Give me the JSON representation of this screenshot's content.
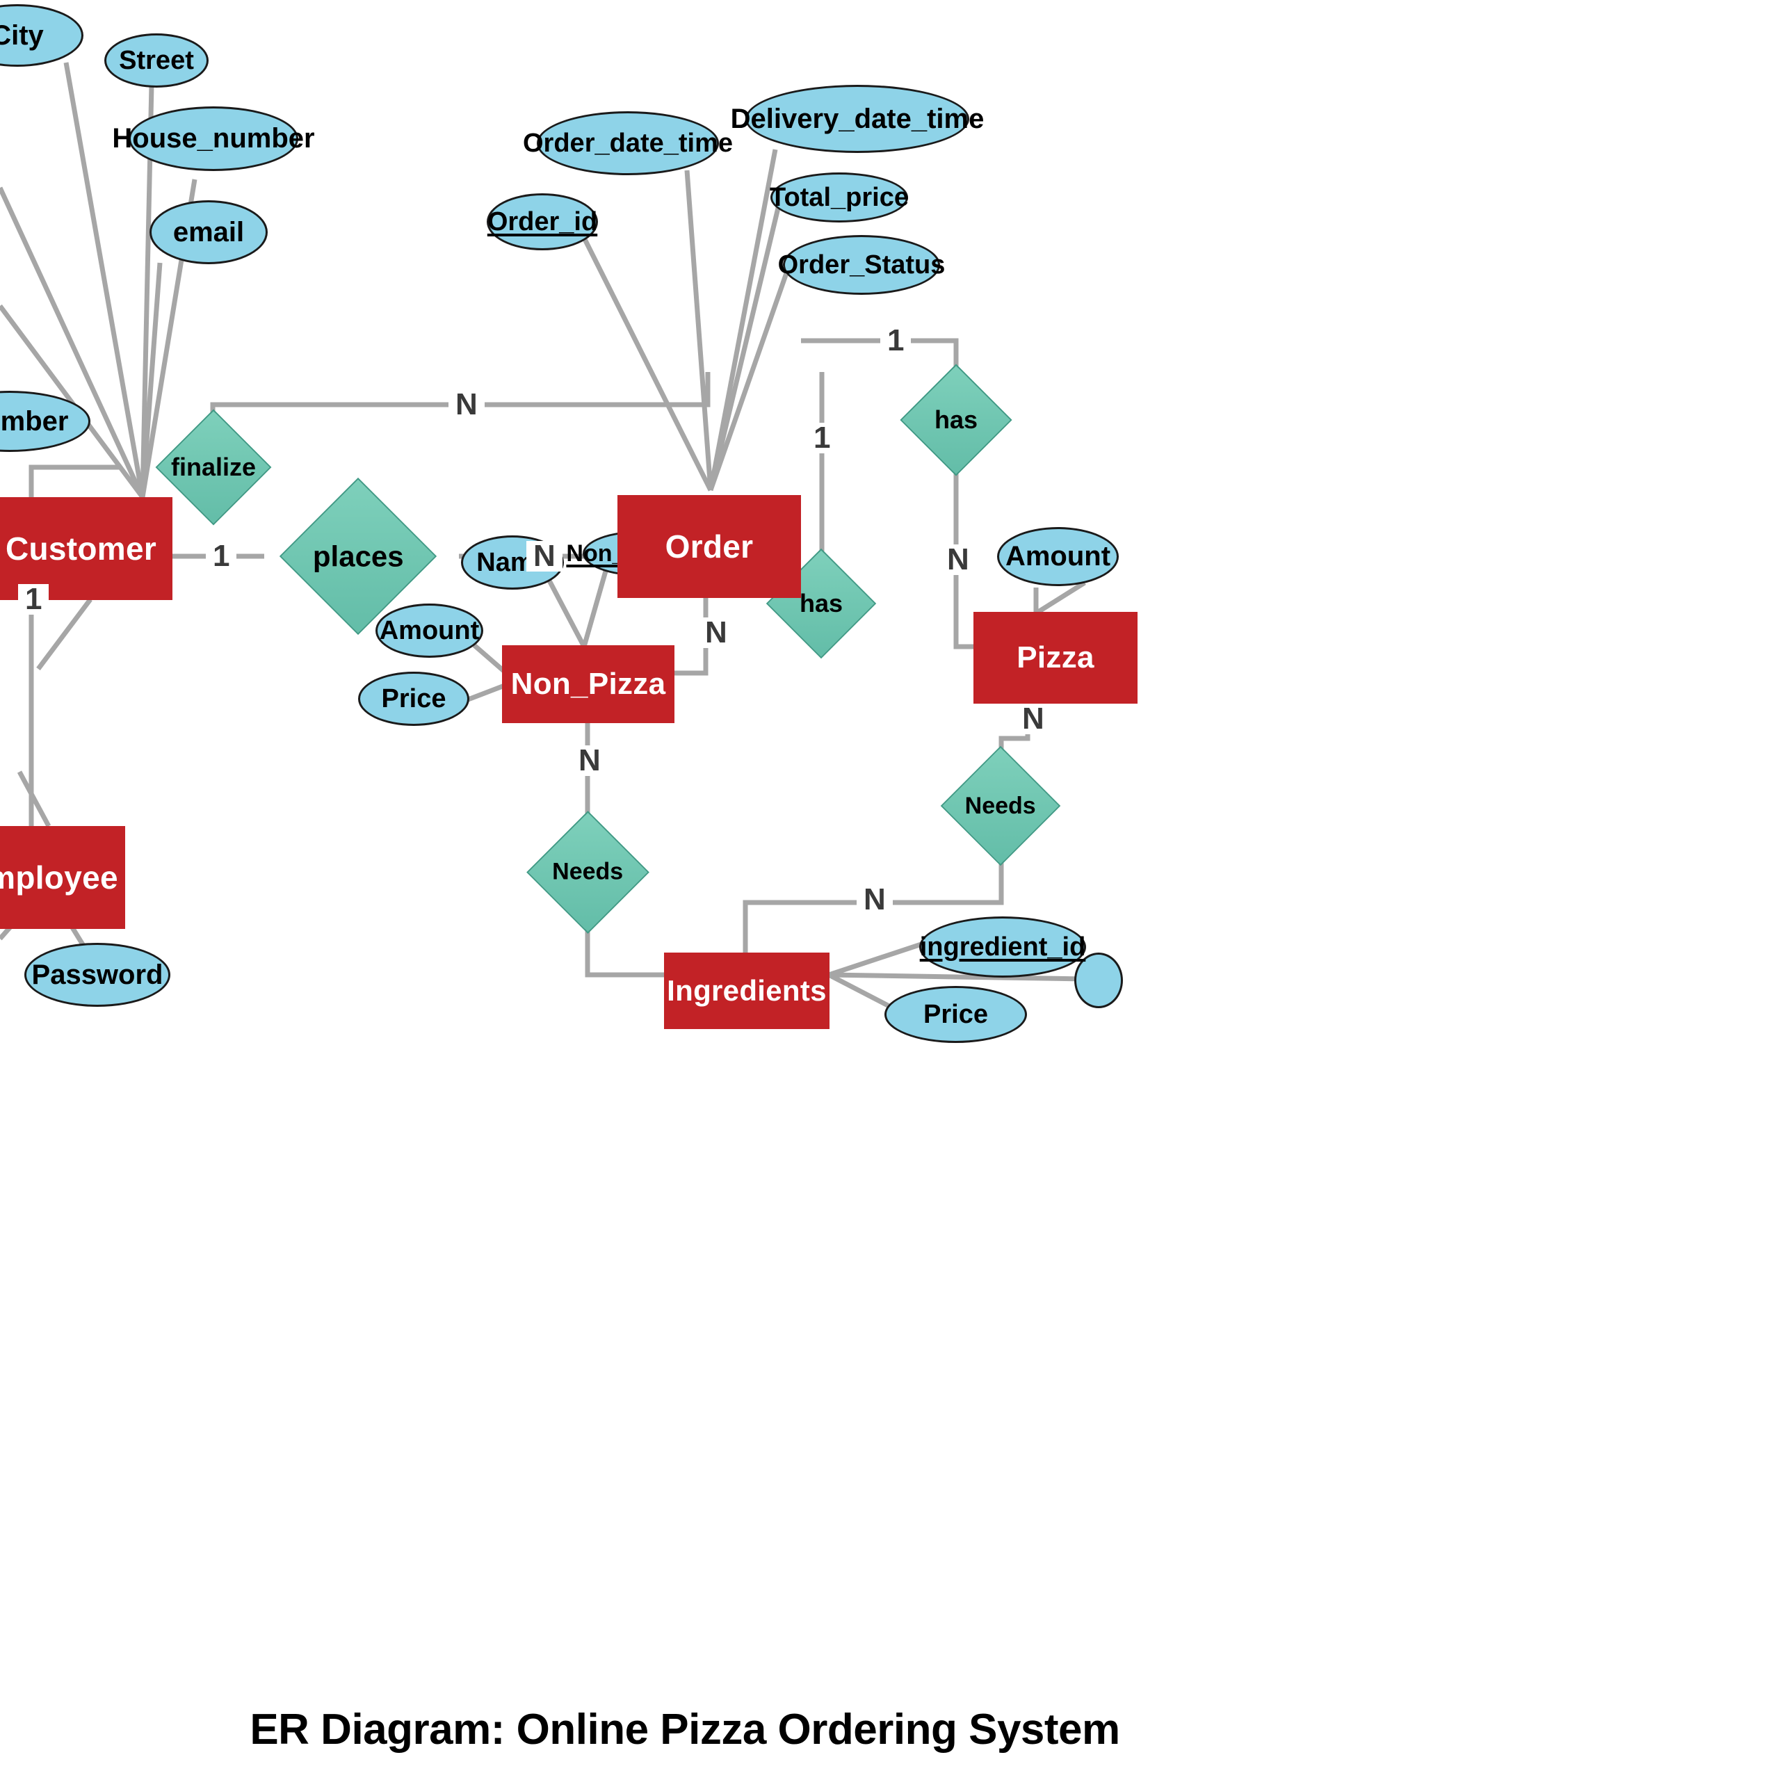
{
  "title": "ER Diagram: Online Pizza Ordering System",
  "palette": {
    "entity_fill": "#c22226",
    "entity_text": "#ffffff",
    "attribute_fill": "#8ed3e8",
    "attribute_stroke": "#1a1a1a",
    "relationship_fill": "#6cc4b0",
    "relationship_stroke": "#3f9a85",
    "connector": "#a6a6a6",
    "background": "#ffffff",
    "label_text": "#3a3a3a"
  },
  "entities": [
    {
      "id": "customer",
      "label": "Customer"
    },
    {
      "id": "order",
      "label": "Order"
    },
    {
      "id": "employee",
      "label": "Employee"
    },
    {
      "id": "non_pizza",
      "label": "Non_Pizza"
    },
    {
      "id": "pizza",
      "label": "Pizza"
    },
    {
      "id": "ingredients",
      "label": "Ingredients"
    }
  ],
  "relationships": [
    {
      "id": "places",
      "label": "places"
    },
    {
      "id": "finalize",
      "label": "finalize"
    },
    {
      "id": "has_pizza",
      "label": "has"
    },
    {
      "id": "has_nonpizza",
      "label": "has"
    },
    {
      "id": "needs_np",
      "label": "Needs"
    },
    {
      "id": "needs_pz",
      "label": "Needs"
    }
  ],
  "attributes": [
    {
      "id": "city",
      "label": "City",
      "owner": "customer",
      "key": false
    },
    {
      "id": "street",
      "label": "Street",
      "owner": "customer",
      "key": false
    },
    {
      "id": "house_number",
      "label": "House_number",
      "owner": "customer",
      "key": false
    },
    {
      "id": "email",
      "label": "email",
      "owner": "customer",
      "key": false
    },
    {
      "id": "phone_number",
      "label": "_number",
      "owner": "customer",
      "key": false
    },
    {
      "id": "order_id",
      "label": "Order_id",
      "owner": "order",
      "key": true
    },
    {
      "id": "order_date_time",
      "label": "Order_date_time",
      "owner": "order",
      "key": false
    },
    {
      "id": "delivery_date_time",
      "label": "Delivery_date_time",
      "owner": "order",
      "key": false
    },
    {
      "id": "total_price",
      "label": "Total_price",
      "owner": "order",
      "key": false
    },
    {
      "id": "order_status",
      "label": "Order_Status",
      "owner": "order",
      "key": false
    },
    {
      "id": "password",
      "label": "Password",
      "owner": "employee",
      "key": false
    },
    {
      "id": "np_name",
      "label": "Name",
      "owner": "non_pizza",
      "key": false
    },
    {
      "id": "np_id",
      "label": "Non_Pizza_id",
      "owner": "non_pizza",
      "key": true
    },
    {
      "id": "np_amount",
      "label": "Amount",
      "owner": "non_pizza",
      "key": false
    },
    {
      "id": "np_price",
      "label": "Price",
      "owner": "non_pizza",
      "key": false
    },
    {
      "id": "pz_amount",
      "label": "Amount",
      "owner": "pizza",
      "key": false
    },
    {
      "id": "ing_id",
      "label": "ingredient_id",
      "owner": "ingredients",
      "key": true
    },
    {
      "id": "ing_price",
      "label": "Price",
      "owner": "ingredients",
      "key": false
    }
  ],
  "cardinalities": [
    {
      "id": "c_cust_places",
      "value": "1"
    },
    {
      "id": "c_places_order",
      "value": "N"
    },
    {
      "id": "c_order_fin",
      "value": "N"
    },
    {
      "id": "c_emp_fin",
      "value": "1"
    },
    {
      "id": "c_order_haspz",
      "value": "1"
    },
    {
      "id": "c_haspz_pizza",
      "value": "N"
    },
    {
      "id": "c_order_hasnp",
      "value": "1"
    },
    {
      "id": "c_hasnp_np",
      "value": "N"
    },
    {
      "id": "c_np_needs",
      "value": "N"
    },
    {
      "id": "c_pz_needs",
      "value": "N"
    },
    {
      "id": "c_needs_ing",
      "value": "N"
    }
  ]
}
